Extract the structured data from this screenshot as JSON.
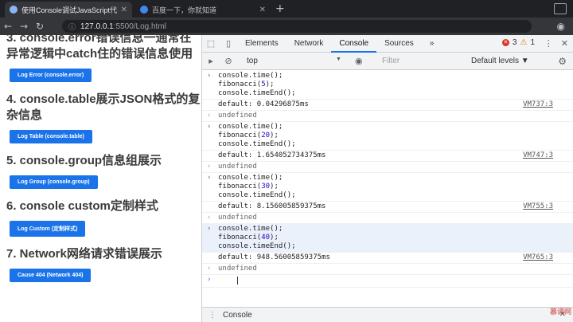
{
  "browser": {
    "tabs": [
      {
        "title": "使用Console调试JavaScript代码",
        "fav": "#8ab4f8"
      },
      {
        "title": "百度一下，你就知道",
        "fav": "#4285f4"
      }
    ],
    "address": {
      "host": "127.0.0.1",
      "path": ":5500/Log.html"
    }
  },
  "page": {
    "headings": [
      "3. console.error错误信息一通常在异常逻辑中catch住的错误信息使用",
      "4. console.table展示JSON格式的复杂信息",
      "5. console.group信息组展示",
      "6. console custom定制样式",
      "7. Network网络请求错误展示"
    ],
    "buttons": [
      "Log Error (console.error)",
      "Log Table (console.table)",
      "Log Group (console.group)",
      "Log Custom (定制样式)",
      "Cause 404 (Network 404)"
    ]
  },
  "devtools": {
    "tabs": [
      "Elements",
      "Network",
      "Console",
      "Sources",
      "»"
    ],
    "selected_tab": "Console",
    "error_count": "3",
    "warning_count": "1",
    "context": "top",
    "filter_placeholder": "Filter",
    "levels": "Default levels ▼",
    "drawer_label": "Console"
  },
  "console": {
    "entries": [
      {
        "code": [
          "console.time();",
          "fibonacci(5);",
          "console.timeEnd();"
        ],
        "output": "default: 0.04296875ms",
        "source": "VM737:3",
        "result": "undefined"
      },
      {
        "code": [
          "console.time();",
          "fibonacci(20);",
          "console.timeEnd();"
        ],
        "output": "default: 1.654052734375ms",
        "source": "VM747:3",
        "result": "undefined"
      },
      {
        "code": [
          "console.time();",
          "fibonacci(30);",
          "console.timeEnd();"
        ],
        "output": "default: 8.156005859375ms",
        "source": "VM755:3",
        "result": "undefined"
      },
      {
        "code": [
          "console.time();",
          "fibonacci(40);",
          "console.timeEnd();"
        ],
        "output": "default: 948.56005859375ms",
        "source": "VM765:3",
        "result": "undefined"
      }
    ]
  },
  "watermark": "慕课网"
}
